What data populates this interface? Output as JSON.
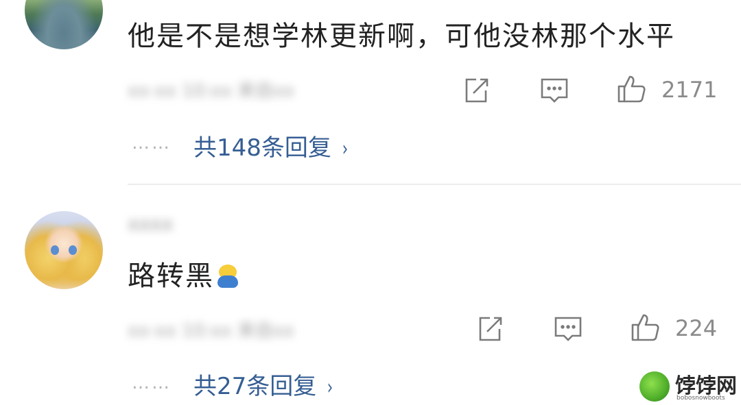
{
  "comments": [
    {
      "text": "他是不是想学林更新啊，可他没林那个水平",
      "meta": "xx-xx 10:xx 来自xx",
      "likes": "2171",
      "replies_dots": "……",
      "replies_label": "共148条回复",
      "chevron": "›"
    },
    {
      "username": "xxxx",
      "text": "路转黑",
      "meta": "xx-xx 10:xx 来自xx",
      "likes": "224",
      "replies_dots": "……",
      "replies_label": "共27条回复",
      "chevron": "›"
    }
  ],
  "icons": {
    "share": "share-icon",
    "comment": "comment-icon",
    "like": "thumbs-up-icon",
    "emoji": "duck-emoji-icon"
  },
  "watermark": {
    "title": "饽饽网",
    "subtitle": "bobosnowboots"
  },
  "colors": {
    "link": "#355e93",
    "muted": "#8a8a8a",
    "icon": "#7a7a7a"
  }
}
